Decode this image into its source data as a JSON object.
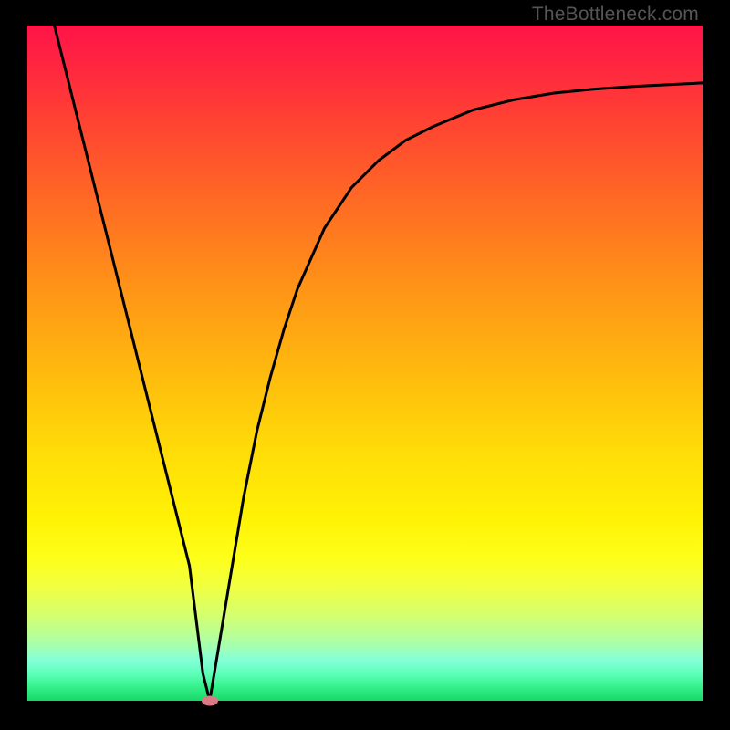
{
  "watermark": "TheBottleneck.com",
  "chart_data": {
    "type": "line",
    "title": "",
    "xlabel": "",
    "ylabel": "",
    "xlim": [
      0,
      100
    ],
    "ylim": [
      0,
      100
    ],
    "grid": false,
    "series": [
      {
        "name": "curve",
        "x": [
          4.0,
          8,
          12,
          16,
          20,
          22,
          24,
          25,
          26,
          27,
          28,
          30,
          32,
          34,
          36,
          38,
          40,
          44,
          48,
          52,
          56,
          60,
          66,
          72,
          78,
          84,
          90,
          96,
          100
        ],
        "values": [
          100,
          84,
          68,
          52,
          36,
          28,
          20,
          12,
          4,
          0,
          6,
          18,
          30,
          40,
          48,
          55,
          61,
          70,
          76,
          80,
          83,
          85,
          87.5,
          89,
          90,
          90.6,
          91,
          91.3,
          91.5
        ]
      }
    ],
    "annotations": [
      {
        "name": "min-marker",
        "x": 27,
        "y": 0
      }
    ],
    "background_gradient": {
      "stops": [
        {
          "pos": 0,
          "color": "#ff1448"
        },
        {
          "pos": 50,
          "color": "#ffb90e"
        },
        {
          "pos": 80,
          "color": "#fdff1a"
        },
        {
          "pos": 100,
          "color": "#18d868"
        }
      ]
    }
  }
}
